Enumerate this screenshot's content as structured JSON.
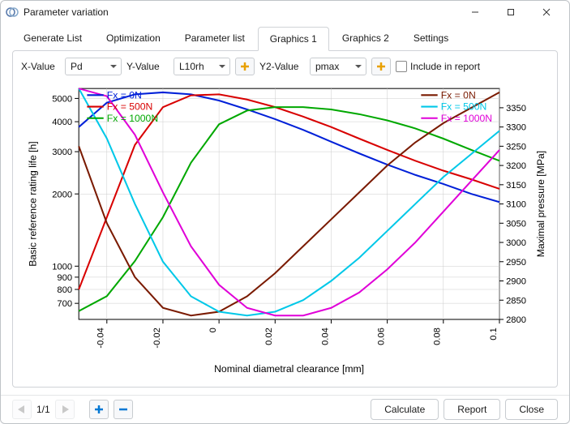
{
  "window": {
    "title": "Parameter variation"
  },
  "tabs": {
    "items": [
      {
        "label": "Generate List"
      },
      {
        "label": "Optimization"
      },
      {
        "label": "Parameter list"
      },
      {
        "label": "Graphics 1",
        "active": true
      },
      {
        "label": "Graphics 2"
      },
      {
        "label": "Settings"
      }
    ]
  },
  "controls": {
    "xLabel": "X-Value",
    "xSelected": "Pd",
    "yLabel": "Y-Value",
    "ySelected": "L10rh",
    "y2Label": "Y2-Value",
    "y2Selected": "pmax",
    "includeLabel": "Include in report"
  },
  "footer": {
    "pageText": "1/1",
    "calculate": "Calculate",
    "report": "Report",
    "close": "Close"
  },
  "colors": {
    "blue": "#0020d8",
    "red": "#d80000",
    "green": "#00a800",
    "darkred": "#7a1a00",
    "cyan": "#00c8e8",
    "magenta": "#e000d8"
  },
  "chart_data": {
    "type": "line",
    "xlabel": "Nominal diametral clearance [mm]",
    "ylabel": "Basic reference rating life [h]",
    "y2label": "Maximal pressure [MPa]",
    "xlim": [
      -0.05,
      0.1
    ],
    "ylim": [
      600,
      5500
    ],
    "y2lim": [
      2800,
      3400
    ],
    "yscale": "log",
    "xticks": [
      -0.04,
      -0.02,
      0,
      0.02,
      0.04,
      0.06,
      0.08,
      0.1
    ],
    "yticks": [
      700,
      800,
      900,
      1000,
      2000,
      3000,
      4000,
      5000
    ],
    "y2ticks": [
      2800,
      2850,
      2900,
      2950,
      3000,
      3050,
      3100,
      3150,
      3200,
      3250,
      3300,
      3350
    ],
    "x": [
      -0.05,
      -0.04,
      -0.03,
      -0.02,
      -0.01,
      0,
      0.01,
      0.02,
      0.03,
      0.04,
      0.05,
      0.06,
      0.07,
      0.08,
      0.09,
      0.1
    ],
    "series": [
      {
        "name": "Fx = 0N",
        "axis": "y",
        "color": "blue",
        "values": [
          3800,
          4800,
          5200,
          5300,
          5200,
          4900,
          4500,
          4100,
          3700,
          3300,
          2950,
          2650,
          2400,
          2200,
          2000,
          1850
        ]
      },
      {
        "name": "Fx = 500N",
        "axis": "y",
        "color": "red",
        "values": [
          800,
          1600,
          3200,
          4600,
          5150,
          5200,
          4950,
          4600,
          4200,
          3800,
          3400,
          3050,
          2750,
          2500,
          2300,
          2100
        ]
      },
      {
        "name": "Fx = 1000N",
        "axis": "y",
        "color": "green",
        "values": [
          650,
          750,
          1050,
          1600,
          2700,
          3900,
          4450,
          4600,
          4600,
          4500,
          4300,
          4050,
          3750,
          3400,
          3050,
          2750
        ]
      },
      {
        "name": "Fx = 0N",
        "axis": "y2",
        "color": "darkred",
        "values": [
          3250,
          3050,
          2910,
          2830,
          2810,
          2820,
          2860,
          2920,
          2990,
          3060,
          3130,
          3200,
          3260,
          3310,
          3350,
          3390
        ]
      },
      {
        "name": "Fx = 500N",
        "axis": "y2",
        "color": "cyan",
        "values": [
          3400,
          3270,
          3100,
          2950,
          2860,
          2820,
          2810,
          2820,
          2850,
          2900,
          2960,
          3030,
          3100,
          3170,
          3230,
          3290
        ]
      },
      {
        "name": "Fx = 1000N",
        "axis": "y2",
        "color": "magenta",
        "values": [
          3400,
          3380,
          3280,
          3130,
          2990,
          2890,
          2830,
          2810,
          2810,
          2830,
          2870,
          2930,
          3000,
          3080,
          3160,
          3240
        ]
      }
    ],
    "legend": {
      "left": [
        "Fx = 0N",
        "Fx = 500N",
        "Fx = 1000N"
      ],
      "right": [
        "Fx = 0N",
        "Fx = 500N",
        "Fx = 1000N"
      ]
    }
  }
}
